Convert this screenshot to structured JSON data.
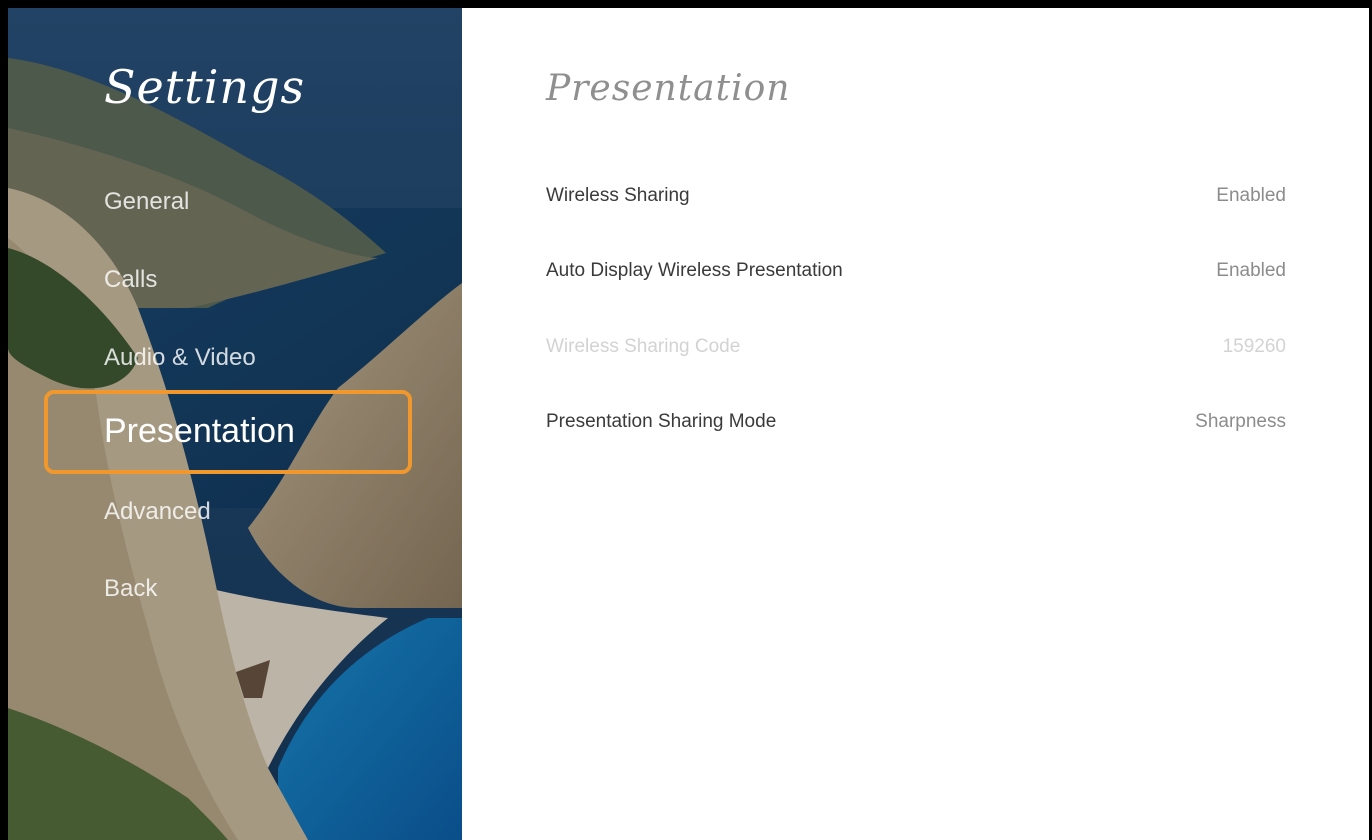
{
  "sidebar": {
    "title": "Settings",
    "items": [
      {
        "label": "General",
        "selected": false
      },
      {
        "label": "Calls",
        "selected": false
      },
      {
        "label": "Audio & Video",
        "selected": false
      },
      {
        "label": "Presentation",
        "selected": true
      },
      {
        "label": "Advanced",
        "selected": false
      },
      {
        "label": "Back",
        "selected": false
      }
    ],
    "focus_color": "#f0982e"
  },
  "main": {
    "title": "Presentation",
    "settings": [
      {
        "label": "Wireless Sharing",
        "value": "Enabled",
        "enabled": true
      },
      {
        "label": "Auto Display Wireless Presentation",
        "value": "Enabled",
        "enabled": true
      },
      {
        "label": "Wireless Sharing Code",
        "value": "159260",
        "enabled": false
      },
      {
        "label": "Presentation Sharing Mode",
        "value": "Sharpness",
        "enabled": true
      }
    ]
  }
}
